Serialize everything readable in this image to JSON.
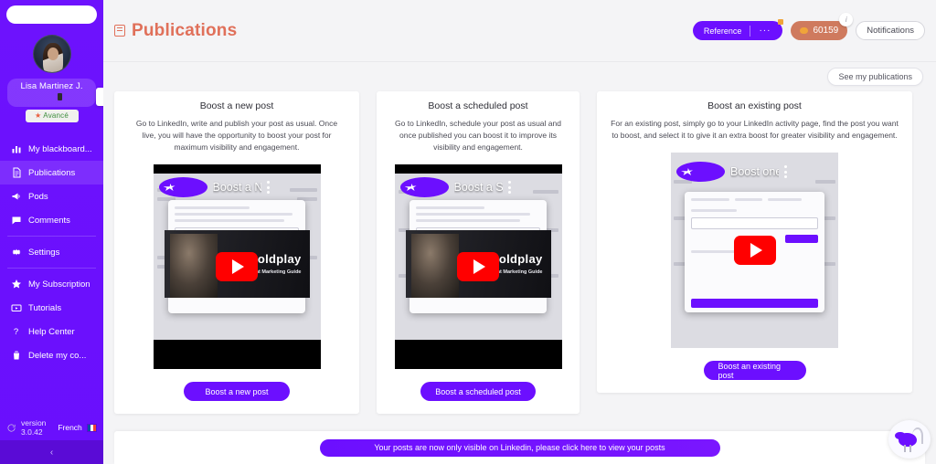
{
  "sidebar": {
    "search_placeholder": "",
    "profile": {
      "name": "Lisa  Martinez J.",
      "plan_badge": "Avancé",
      "avatar_alt": "user-avatar"
    },
    "items": [
      {
        "label": "My blackboard...",
        "icon": "bar-chart-icon",
        "active": false
      },
      {
        "label": "Publications",
        "icon": "document-icon",
        "active": true
      },
      {
        "label": "Pods",
        "icon": "megaphone-icon",
        "active": false
      },
      {
        "label": "Comments",
        "icon": "comment-icon",
        "active": false
      },
      {
        "label": "Settings",
        "icon": "gear-icon",
        "active": false
      },
      {
        "label": "My Subscription",
        "icon": "star-icon",
        "active": false
      },
      {
        "label": "Tutorials",
        "icon": "video-icon",
        "active": false
      },
      {
        "label": "Help Center",
        "icon": "question-icon",
        "active": false
      },
      {
        "label": "Delete my co...",
        "icon": "trash-icon",
        "active": false
      }
    ],
    "footer": {
      "version_label": "version",
      "version_number": "3.0.42",
      "language": "French"
    },
    "collapse_chevron": "‹"
  },
  "header": {
    "title": "Publications",
    "title_icon": "book-icon",
    "reference_button": "Reference",
    "reference_dots": "···",
    "coin_count": "60159",
    "coin_icon": "coin-icon",
    "info_icon": "i",
    "notifications_button": "Notifications",
    "see_my_publications": "See my publications"
  },
  "cards": [
    {
      "title": "Boost a new post",
      "description": "Go to LinkedIn, write and publish your post as usual. Once live, you will have the opportunity to boost your post for maximum visibility and engagement.",
      "video_title": "Boost a NEW Linked...",
      "video_overlay_title": "Coldplay",
      "video_overlay_subtitle": "Sold-Out Concert Strategy: Event Marketing Guide",
      "button": "Boost a new post"
    },
    {
      "title": "Boost a scheduled post",
      "description": "Go to LinkedIn, schedule your post as usual and once published you can boost it to improve its visibility and engagement.",
      "video_title": "Boost a SCHEDULE...",
      "video_overlay_title": "Coldplay",
      "video_overlay_subtitle": "Sold-Out Concert Strategy: Event Marketing Guide",
      "button": "Boost a scheduled post"
    },
    {
      "title": "Boost an existing post",
      "description": "For an existing post, simply go to your LinkedIn activity page, find the post you want to boost, and select it to give it an extra boost for greater visibility and engagement.",
      "video_title": "Boost one of your Li...",
      "video_overlay_title": "",
      "video_overlay_subtitle": "",
      "button": "Boost an existing post"
    }
  ],
  "bottom": {
    "banner_text": "Your posts are now only visible on Linkedin, please click here to view your posts",
    "mascot_icon": "bird-mascot-icon"
  },
  "colors": {
    "brand_purple": "#6c0fff",
    "title_orange": "#e0705a",
    "coin_pill": "#cf7a5e",
    "play_red": "#ff0000"
  }
}
